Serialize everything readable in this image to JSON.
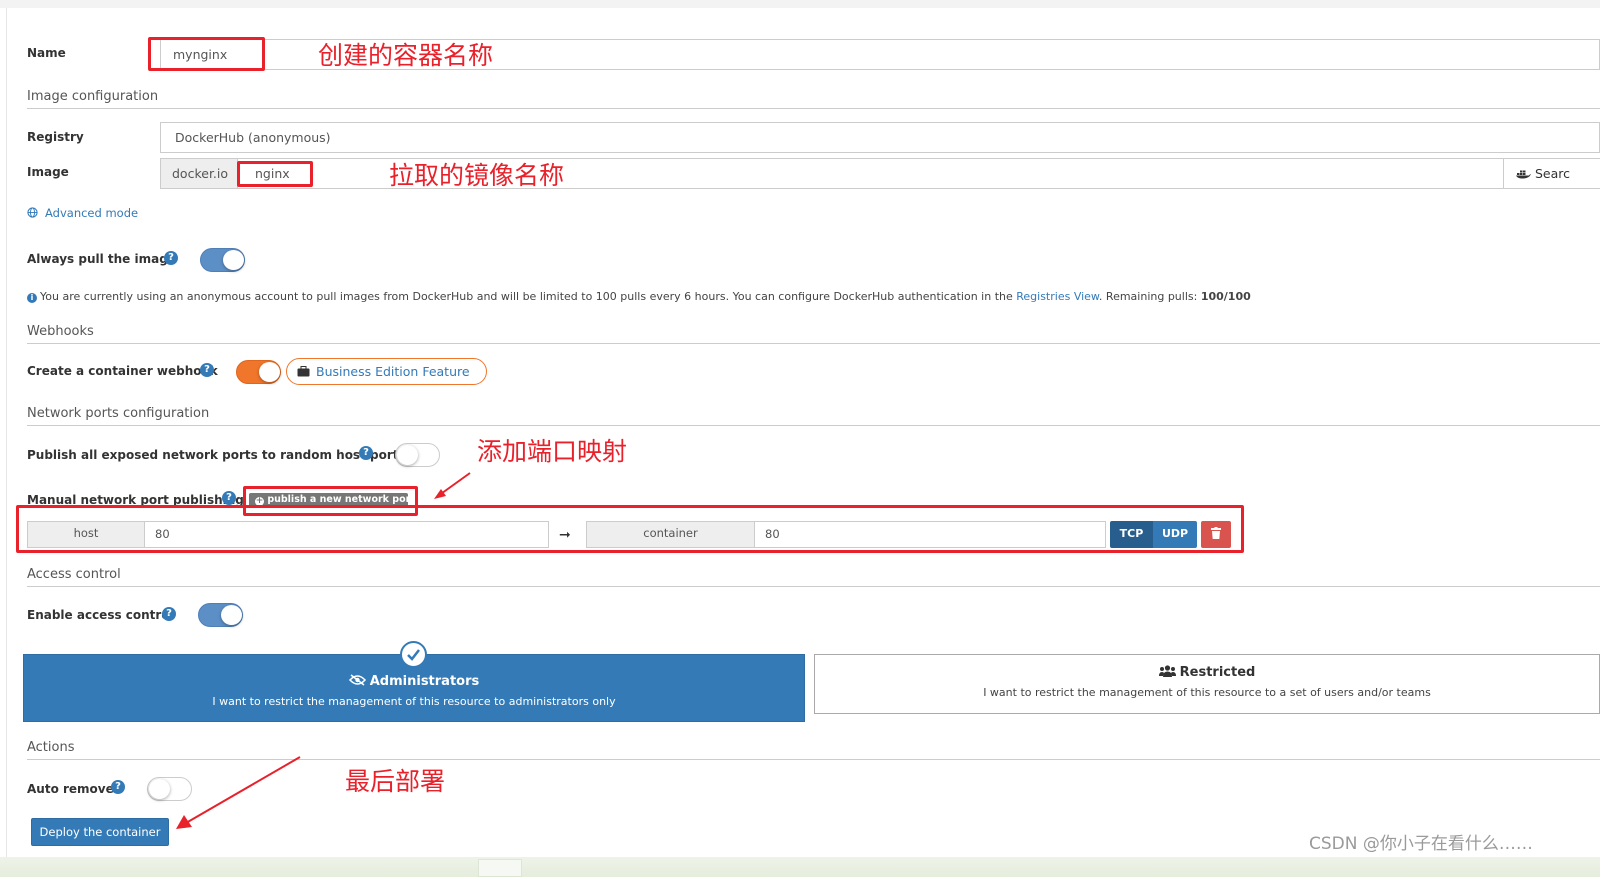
{
  "form": {
    "name": {
      "label": "Name",
      "value": "mynginx"
    },
    "image_section": "Image configuration",
    "registry": {
      "label": "Registry",
      "value": "DockerHub (anonymous)"
    },
    "image": {
      "label": "Image",
      "prefix": "docker.io",
      "value": "nginx",
      "search_label": "Searc"
    },
    "advanced_mode": "Advanced mode",
    "always_pull": {
      "label": "Always pull the image",
      "enabled": true
    },
    "pull_info": {
      "text": "You are currently using an anonymous account to pull images from DockerHub and will be limited to 100 pulls every 6 hours. You can configure DockerHub authentication in the",
      "link": "Registries View",
      "remaining_label": ". Remaining pulls:",
      "remaining_value": "100/100"
    },
    "webhooks_section": "Webhooks",
    "webhook": {
      "label": "Create a container webhook",
      "enabled": true,
      "badge": "Business Edition Feature"
    },
    "network_section": "Network ports configuration",
    "publish_all": {
      "label": "Publish all exposed network ports to random host ports",
      "enabled": false
    },
    "manual_ports": {
      "label": "Manual network port publishing",
      "button": "publish a new network port"
    },
    "port_mapping": {
      "host_label": "host",
      "host_value": "80",
      "container_label": "container",
      "container_value": "80",
      "protocols": [
        "TCP",
        "UDP"
      ],
      "selected_protocol": "TCP"
    },
    "access_section": "Access control",
    "access_control": {
      "label": "Enable access control",
      "enabled": true
    },
    "administrators": {
      "title": "Administrators",
      "description": "I want to restrict the management of this resource to administrators only",
      "selected": true
    },
    "restricted": {
      "title": "Restricted",
      "description": "I want to restrict the management of this resource to a set of users and/or teams"
    },
    "actions_section": "Actions",
    "auto_remove": {
      "label": "Auto remove",
      "enabled": false
    },
    "deploy_button": "Deploy the container"
  },
  "annotations": {
    "name_note": "创建的容器名称",
    "image_note": "拉取的镜像名称",
    "port_note": "添加端口映射",
    "deploy_note": "最后部署"
  },
  "watermark": "CSDN @你小子在看什么……",
  "colors": {
    "primary": "#337ab7",
    "admin_bg": "#337ab7",
    "annotation_red": "#e8212b",
    "orange_toggle": "#f0762b",
    "danger": "#d9534f",
    "tcp_active": "#285e8e"
  },
  "icons": [
    "globe-icon",
    "question-icon",
    "info-icon",
    "briefcase-icon",
    "plus-circle-icon",
    "arrow-right-icon",
    "trash-icon",
    "check-icon",
    "eye-slash-icon",
    "users-icon",
    "docker-icon"
  ]
}
